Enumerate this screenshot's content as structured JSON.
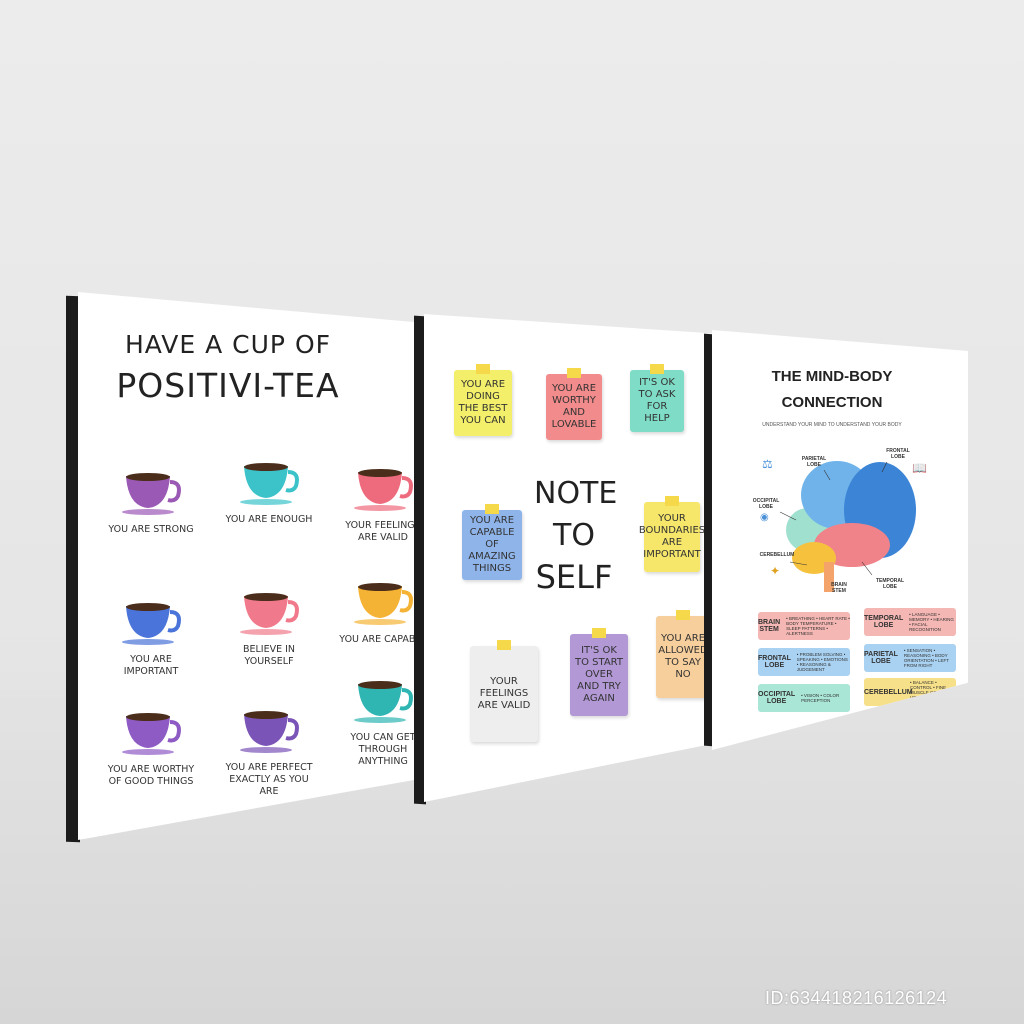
{
  "posters": {
    "tea": {
      "title_line1": "HAVE A CUP OF",
      "title_line2": "POSITIVI-TEA",
      "cups": [
        {
          "label": "YOU ARE STRONG",
          "color": "#9b59b6"
        },
        {
          "label": "YOU ARE ENOUGH",
          "color": "#3cc3c9"
        },
        {
          "label": "YOUR FEELINGS ARE VALID",
          "color": "#ee6b7e"
        },
        {
          "label": "YOU ARE IMPORTANT",
          "color": "#4a74d9"
        },
        {
          "label": "BELIEVE IN YOURSELF",
          "color": "#f07a8c"
        },
        {
          "label": "YOU ARE CAPABLE",
          "color": "#f5b335"
        },
        {
          "label": "YOU ARE WORTHY OF GOOD THINGS",
          "color": "#8e5bc5"
        },
        {
          "label": "YOU ARE PERFECT EXACTLY AS YOU ARE",
          "color": "#7b54b8"
        },
        {
          "label": "YOU CAN GET THROUGH ANYTHING",
          "color": "#2fb5b2"
        }
      ]
    },
    "notes": {
      "title_line1": "NOTE",
      "title_line2": "TO",
      "title_line3": "SELF",
      "notes": [
        {
          "text": "YOU ARE DOING THE BEST YOU CAN",
          "color": "#f3ef6a"
        },
        {
          "text": "YOU ARE WORTHY AND LOVABLE",
          "color": "#f28b8b"
        },
        {
          "text": "IT'S OK TO ASK FOR HELP",
          "color": "#7fdcc6"
        },
        {
          "text": "YOU ARE CAPABLE OF AMAZING THINGS",
          "color": "#8fb4ea"
        },
        {
          "text": "YOUR BOUNDARIES ARE IMPORTANT",
          "color": "#f6e76a"
        },
        {
          "text": "YOUR FEELINGS ARE VALID",
          "color": "#eeeeee"
        },
        {
          "text": "IT'S OK TO START OVER AND TRY AGAIN",
          "color": "#b299d6"
        },
        {
          "text": "YOU ARE ALLOWED TO SAY NO",
          "color": "#f7cf9c"
        }
      ]
    },
    "brain": {
      "title_line1": "THE MIND-BODY",
      "title_line2": "CONNECTION",
      "subtitle": "UNDERSTAND YOUR MIND TO UNDERSTAND YOUR BODY",
      "labels": {
        "parietal": "PARIETAL LOBE",
        "frontal": "FRONTAL LOBE",
        "occipital": "OCCIPITAL LOBE",
        "cerebellum": "CEREBELLUM",
        "brain_stem": "BRAIN STEM",
        "temporal": "TEMPORAL LOBE"
      },
      "boxes": [
        {
          "name": "BRAIN STEM",
          "items": "• BREATHING • HEART RATE • BODY TEMPERATURE • SLEEP PATTERNS • ALERTNESS",
          "color": "#f4b7b3"
        },
        {
          "name": "TEMPORAL LOBE",
          "items": "• LANGUAGE • MEMORY • HEARING • FACIAL RECOGNITION",
          "color": "#f4b7b3"
        },
        {
          "name": "FRONTAL LOBE",
          "items": "• PROBLEM SOLVING • SPEAKING • EMOTIONS • REASONING & JUDGEMENT",
          "color": "#a9d2f2"
        },
        {
          "name": "PARIETAL LOBE",
          "items": "• SENSATION • REASONING • BODY ORIENTATION • LEFT FROM RIGHT",
          "color": "#a9d2f2"
        },
        {
          "name": "OCCIPITAL LOBE",
          "items": "• VISION • COLOR PERCEPTION",
          "color": "#a9e6d5"
        },
        {
          "name": "CEREBELLUM",
          "items": "• BALANCE • CONTROL • FINE MUSCLE CONTROL • VOLUNTARY MOVEMENT",
          "color": "#f7e08a"
        }
      ]
    }
  },
  "watermark": "ID:634418216126124"
}
